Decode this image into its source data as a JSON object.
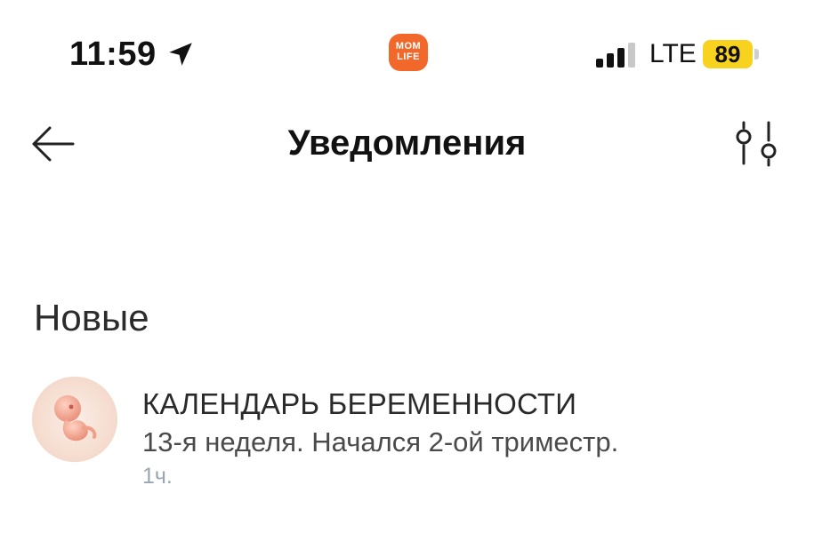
{
  "status_bar": {
    "time": "11:59",
    "app_logo_line1": "MOM",
    "app_logo_line2": "LIFE",
    "network": "LTE",
    "battery": "89",
    "battery_color": "#f7d21f",
    "app_color": "#f2682b"
  },
  "header": {
    "title": "Уведомления",
    "back_icon": "arrow-left-icon",
    "filter_icon": "filter-sliders-icon"
  },
  "section": {
    "title": "Новые"
  },
  "notifications": [
    {
      "title": "КАЛЕНДАРЬ БЕРЕМЕННОСТИ",
      "text": "13-я неделя. Начался 2-ой триместр.",
      "time": "1ч.",
      "icon": "embryo-icon"
    }
  ]
}
